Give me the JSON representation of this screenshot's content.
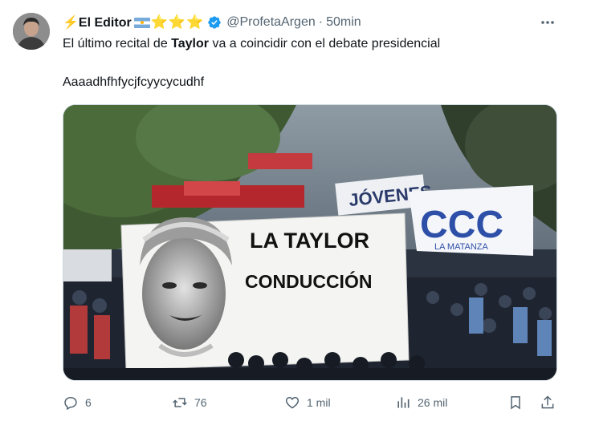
{
  "tweet": {
    "author_name": "⚡El Editor",
    "author_stars": "⭐⭐⭐",
    "handle": "@ProfetaArgen",
    "separator": "·",
    "time": "50min",
    "text_before": "El último recital de ",
    "text_bold": "Taylor",
    "text_after": " va a coincidir con el debate presidencial",
    "text_line2": "Aaaadhfhfycjfcyycycudhf"
  },
  "media": {
    "banner_line1": "LA TAYLOR",
    "banner_line2": "CONDUCCIÓN",
    "flag_letters": "CCC",
    "flag_subtext": "LA MATANZA",
    "sign_text": "JÓVENES"
  },
  "actions": {
    "replies": "6",
    "reposts": "76",
    "likes": "1 mil",
    "views": "26 mil"
  },
  "colors": {
    "text": "#0f1419",
    "secondary": "#536471",
    "verified": "#1d9bf0",
    "star": "#f4b400"
  },
  "icons": [
    "verified-badge-icon",
    "more-options-icon",
    "reply-icon",
    "repost-icon",
    "like-icon",
    "views-icon",
    "bookmark-icon",
    "share-icon"
  ]
}
